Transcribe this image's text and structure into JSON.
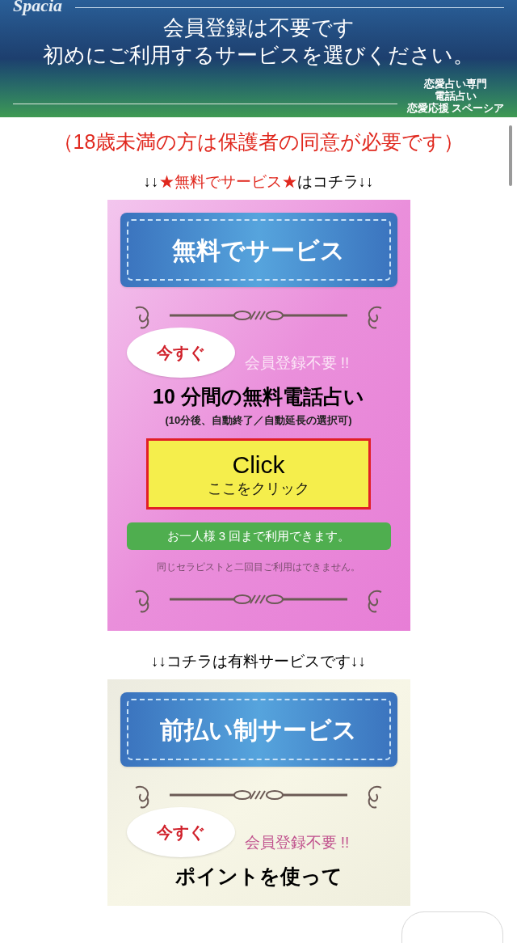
{
  "header": {
    "logo": "Spacia",
    "title_lines": [
      "会員登録は不要です",
      "初めにご利用するサービスを選びください。"
    ],
    "tagline_lines": [
      "恋愛占い専門",
      "電話占い",
      "恋愛応援 スペーシア"
    ]
  },
  "notice": "（18歳未満の方は保護者の同意が必要です）",
  "sections": [
    {
      "label_parts": [
        {
          "text": "↓↓",
          "emphasis": false
        },
        {
          "text": "★無料でサービス★",
          "emphasis": true
        },
        {
          "text": "はコチラ↓↓",
          "emphasis": false
        }
      ],
      "card": {
        "kind": "pink",
        "title": "無料でサービス",
        "bubble": "今すぐ",
        "badge": "会員登録不要 !!",
        "headline": "10 分間の無料電話占い",
        "subline": "(10分後、自動終了／自動延長の選択可)",
        "button": {
          "title": "Click",
          "subtitle": "ここをクリック"
        },
        "limit": "お一人様 3 回まで利用できます。",
        "note": "同じセラピストと二回目ご利用はできません。"
      }
    },
    {
      "label_parts": [
        {
          "text": "↓↓コチラは有料サービスです↓↓",
          "emphasis": false
        }
      ],
      "card": {
        "kind": "cream",
        "title": "前払い制サービス",
        "bubble": "今すぐ",
        "badge": "会員登録不要 !!",
        "headline": "ポイントを使って"
      }
    }
  ]
}
